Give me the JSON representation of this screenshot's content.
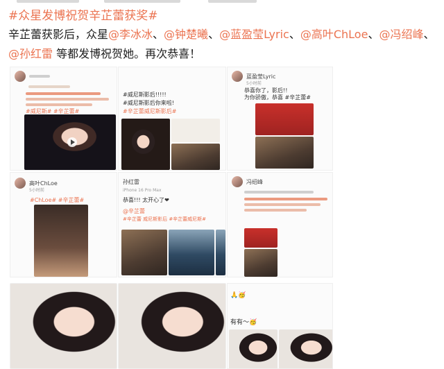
{
  "post": {
    "hashtag": "#众星发博祝贺辛芷蕾获奖#",
    "body_prefix": "辛芷蕾获影后，众星",
    "mentions": [
      "@李冰冰",
      "@钟楚曦",
      "@蓝盈莹Lyric",
      "@高叶ChLoe",
      "@冯绍峰",
      "@孙红雷"
    ],
    "separator": "、",
    "body_suffix": " 等都发博祝贺她。再次恭喜！"
  },
  "screenshots": {
    "card1": {
      "lines": [
        "#威尼斯#",
        "#辛芷蕾#"
      ]
    },
    "card2": {
      "lines": [
        "#威尼斯影后!!!!!",
        "#威尼斯影后你来啦!",
        "#辛芷蕾威尼斯影后#"
      ]
    },
    "card3": {
      "username": "蓝盈莹Lyric",
      "time": "5小时前",
      "lines": [
        "恭喜你了，影后!!",
        "为你骄傲，恭喜 #辛芷蕾#"
      ]
    },
    "card4": {
      "username": "高叶ChLoe",
      "time": "5小时前",
      "lines": [
        "#ChLoe#",
        "#辛芷蕾#"
      ]
    },
    "card5": {
      "username": "孙红雷",
      "source": "iPhone 16 Pro Max",
      "lines": [
        "恭喜!!! 太开心了❤",
        "@辛芷蕾"
      ],
      "tags": "#辛芷蕾 威尼斯影后 #辛芷蕾威尼斯#"
    },
    "card6": {
      "username": "冯绍峰"
    },
    "side": {
      "emoji_line1": "🙏🥳",
      "emoji_line2": "有有～🥳"
    }
  }
}
